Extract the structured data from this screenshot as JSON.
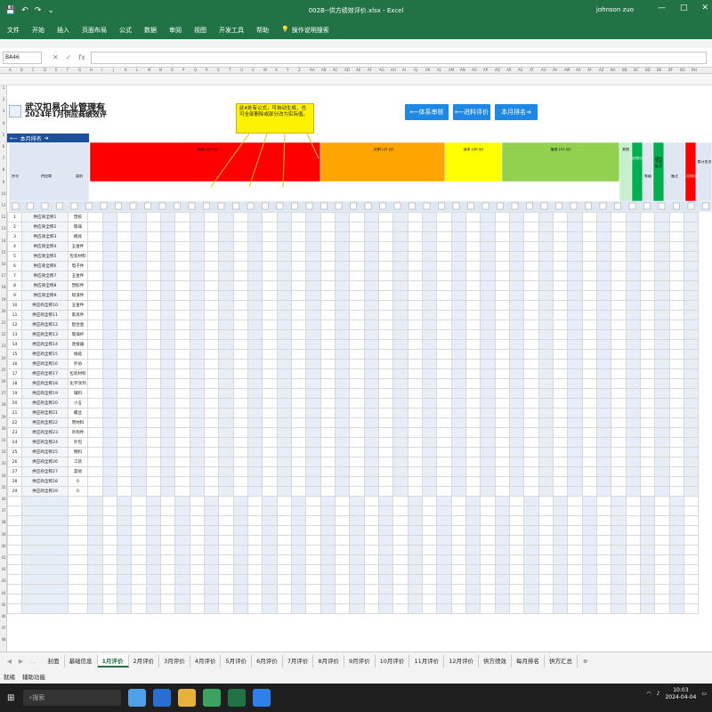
{
  "window": {
    "title": "002B--供方绩效评价.xlsx  -  Excel",
    "user": "johnson zuo",
    "controls": {
      "minimize": "—",
      "maximize": "□",
      "close": "✕"
    }
  },
  "quick_access": [
    "💾",
    "↶",
    "↷",
    "⌄"
  ],
  "ribbon_tabs": [
    "文件",
    "开始",
    "插入",
    "页面布局",
    "公式",
    "数据",
    "审阅",
    "视图",
    "开发工具",
    "帮助",
    "操作说明搜索"
  ],
  "name_box": "BA46",
  "formula_icons": [
    "✕",
    "✓",
    "fx"
  ],
  "sheet": {
    "company_title": "武汉扣易企业管理有",
    "subtitle": "2024年1月供应商绩效评",
    "rank_label": "本月排名",
    "nav_buttons": [
      "体系审核",
      "进料评价",
      "本月排名"
    ],
    "callout": "此4处有公式，可自动生成，也可全部删除或部分改为实际值。",
    "header_groups": {
      "quality": "质量 (35 分)",
      "delivery": "交期 (25 分)",
      "cost": "成本 (20 分)",
      "service": "服务 (15 分)",
      "other": "其他"
    },
    "left_headers": [
      "序号",
      "供应商",
      "类别"
    ],
    "right_headers": [
      "总得分",
      "等级",
      "进料不良批次",
      "备注",
      "月排名",
      "累计名次"
    ],
    "supplier_category_rows": [
      [
        "1",
        "供应商全称1",
        "塑胶"
      ],
      [
        "2",
        "供应商全称2",
        "玻璃"
      ],
      [
        "3",
        "供应商全称3",
        "模具"
      ],
      [
        "4",
        "供应商全称4",
        "五金件"
      ],
      [
        "5",
        "供应商全称5",
        "包装材料"
      ],
      [
        "6",
        "供应商全称6",
        "电子件"
      ],
      [
        "7",
        "供应商全称7",
        "五金件"
      ],
      [
        "8",
        "供应商全称8",
        "塑胶件"
      ],
      [
        "9",
        "供应商全称9",
        "喷漆件"
      ],
      [
        "10",
        "供应商全称10",
        "五金件"
      ],
      [
        "11",
        "供应商全称11",
        "家具件"
      ],
      [
        "12",
        "供应商全称12",
        "铝合金"
      ],
      [
        "13",
        "供应商全称13",
        "玻璃纤"
      ],
      [
        "14",
        "供应商全称14",
        "连接器"
      ],
      [
        "15",
        "供应商全称15",
        "线缆"
      ],
      [
        "16",
        "供应商全称16",
        "外协"
      ],
      [
        "17",
        "供应商全称17",
        "包装材料"
      ],
      [
        "18",
        "供应商全称18",
        "化学涂剂"
      ],
      [
        "19",
        "供应商全称19",
        "辅料"
      ],
      [
        "20",
        "供应商全称20",
        "小五"
      ],
      [
        "21",
        "供应商全称21",
        "螺丝"
      ],
      [
        "22",
        "供应商全称22",
        "原材料"
      ],
      [
        "23",
        "供应商全称23",
        "外购件"
      ],
      [
        "24",
        "供应商全称24",
        "外包"
      ],
      [
        "25",
        "供应商全称25",
        "物料"
      ],
      [
        "26",
        "供应商全称26",
        "工装"
      ],
      [
        "27",
        "供应商全称27",
        "其他"
      ],
      [
        "28",
        "供应商全称28",
        "0"
      ],
      [
        "29",
        "供应商全称29",
        "0"
      ]
    ]
  },
  "sheet_tabs": [
    "封面",
    "基础信息",
    "1月评价",
    "2月评价",
    "3月评价",
    "4月评价",
    "5月评价",
    "6月评价",
    "7月评价",
    "8月评价",
    "9月评价",
    "10月评价",
    "11月评价",
    "12月评价",
    "供方绩效",
    "每月排名",
    "供方汇总"
  ],
  "active_tab": "1月评价",
  "status": {
    "ready": "就绪",
    "mode": "辅助功能"
  },
  "taskbar": {
    "search": "搜索",
    "time": "10:03",
    "date": "2024-04-04"
  },
  "colors": {
    "excel_green": "#217346",
    "quality_red": "#ff0000",
    "delivery_orange": "#ffa500",
    "cost_yellow": "#ffff00",
    "service_green": "#92d050",
    "other_green": "#00b050",
    "btn_blue": "#1e88e5"
  }
}
